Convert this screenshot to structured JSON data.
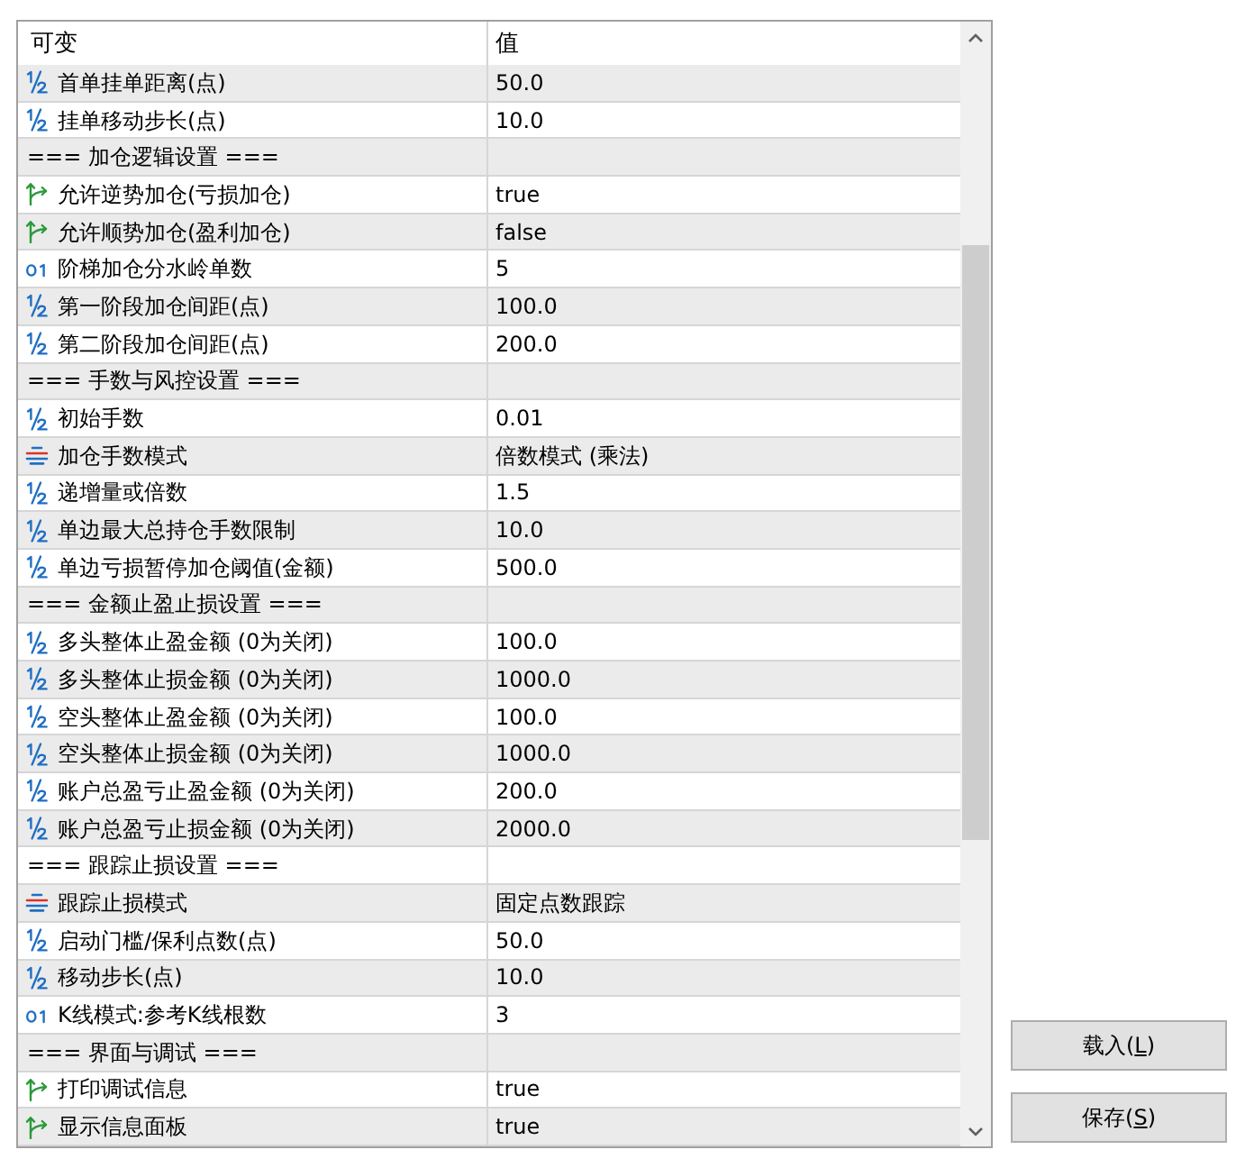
{
  "table": {
    "columns": [
      {
        "label": "可变"
      },
      {
        "label": "值"
      }
    ],
    "rows": [
      {
        "kind": "double",
        "name": "首单挂单距离(点)",
        "value": "50.0"
      },
      {
        "kind": "double",
        "name": "挂单移动步长(点)",
        "value": "10.0"
      },
      {
        "kind": "section",
        "name": "=== 加仓逻辑设置 ==="
      },
      {
        "kind": "bool",
        "name": "允许逆势加仓(亏损加仓)",
        "value": "true"
      },
      {
        "kind": "bool",
        "name": "允许顺势加仓(盈利加仓)",
        "value": "false"
      },
      {
        "kind": "int",
        "name": "阶梯加仓分水岭单数",
        "value": "5"
      },
      {
        "kind": "double",
        "name": "第一阶段加仓间距(点)",
        "value": "100.0"
      },
      {
        "kind": "double",
        "name": "第二阶段加仓间距(点)",
        "value": "200.0"
      },
      {
        "kind": "section",
        "name": "=== 手数与风控设置 ==="
      },
      {
        "kind": "double",
        "name": "初始手数",
        "value": "0.01"
      },
      {
        "kind": "enum",
        "name": "加仓手数模式",
        "value": "倍数模式 (乘法)"
      },
      {
        "kind": "double",
        "name": "递增量或倍数",
        "value": "1.5"
      },
      {
        "kind": "double",
        "name": "单边最大总持仓手数限制",
        "value": "10.0"
      },
      {
        "kind": "double",
        "name": "单边亏损暂停加仓阈值(金额)",
        "value": "500.0"
      },
      {
        "kind": "section",
        "name": "=== 金额止盈止损设置 ==="
      },
      {
        "kind": "double",
        "name": "多头整体止盈金额 (0为关闭)",
        "value": "100.0"
      },
      {
        "kind": "double",
        "name": "多头整体止损金额 (0为关闭)",
        "value": "1000.0"
      },
      {
        "kind": "double",
        "name": "空头整体止盈金额 (0为关闭)",
        "value": "100.0"
      },
      {
        "kind": "double",
        "name": "空头整体止损金额 (0为关闭)",
        "value": "1000.0"
      },
      {
        "kind": "double",
        "name": "账户总盈亏止盈金额 (0为关闭)",
        "value": "200.0"
      },
      {
        "kind": "double",
        "name": "账户总盈亏止损金额 (0为关闭)",
        "value": "2000.0"
      },
      {
        "kind": "section",
        "name": "=== 跟踪止损设置 ==="
      },
      {
        "kind": "enum",
        "name": "跟踪止损模式",
        "value": "固定点数跟踪"
      },
      {
        "kind": "double",
        "name": "启动门槛/保利点数(点)",
        "value": "50.0"
      },
      {
        "kind": "double",
        "name": "移动步长(点)",
        "value": "10.0"
      },
      {
        "kind": "int",
        "name": "K线模式:参考K线根数",
        "value": "3"
      },
      {
        "kind": "section",
        "name": "=== 界面与调试 ==="
      },
      {
        "kind": "bool",
        "name": "打印调试信息",
        "value": "true"
      },
      {
        "kind": "bool",
        "name": "显示信息面板",
        "value": "true"
      }
    ]
  },
  "buttons": [
    {
      "label_parts": [
        {
          "text": "载入(",
          "underlined": false
        },
        {
          "text": "L",
          "underlined": true
        },
        {
          "text": ")",
          "underlined": false
        }
      ]
    },
    {
      "label_parts": [
        {
          "text": "保存(",
          "underlined": false
        },
        {
          "text": "S",
          "underlined": true
        },
        {
          "text": ")",
          "underlined": false
        }
      ]
    }
  ]
}
